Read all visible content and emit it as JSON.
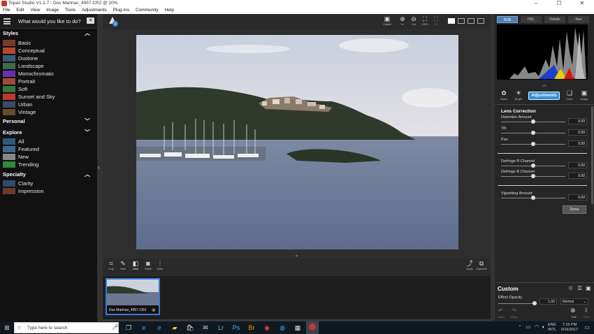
{
  "window": {
    "title": "Topaz Studio V1.2.7 - Dos Marinas_4957.CR2 @ 20%",
    "controls": [
      "–",
      "☐",
      "✕"
    ]
  },
  "menu": [
    "File",
    "Edit",
    "View",
    "Image",
    "Tools",
    "Adjustments",
    "Plug-ins",
    "Community",
    "Help"
  ],
  "search": {
    "placeholder": "What would you like to do?"
  },
  "styles": {
    "title": "Styles",
    "items": [
      {
        "label": "Basic",
        "color": "#7a3b2e"
      },
      {
        "label": "Conceptual",
        "color": "#b5482f"
      },
      {
        "label": "Duotone",
        "color": "#3a5a7a"
      },
      {
        "label": "Landscape",
        "color": "#3f6b4a"
      },
      {
        "label": "Monochromatic",
        "color": "#6a2fb0"
      },
      {
        "label": "Portrait",
        "color": "#a04a3a"
      },
      {
        "label": "Soft",
        "color": "#2f7a3a"
      },
      {
        "label": "Sunset and Sky",
        "color": "#c0392b"
      },
      {
        "label": "Urban",
        "color": "#3a4a6a"
      },
      {
        "label": "Vintage",
        "color": "#6a4a2a"
      }
    ]
  },
  "personal": {
    "title": "Personal"
  },
  "explore": {
    "title": "Explore",
    "items": [
      {
        "label": "All",
        "color": "#2f5a7a"
      },
      {
        "label": "Featured",
        "color": "#3a6a8a"
      },
      {
        "label": "New",
        "color": "#888888"
      },
      {
        "label": "Trending",
        "color": "#2f8a3a"
      }
    ]
  },
  "specialty": {
    "title": "Specialty",
    "items": [
      {
        "label": "Clarity",
        "color": "#2f4a6a"
      },
      {
        "label": "Impression",
        "color": "#6a3a2a"
      }
    ]
  },
  "topbar": {
    "original": "Original",
    "in": "In",
    "out": "Out",
    "zoom": "100%",
    "fit": "Fit"
  },
  "tools": {
    "crop": "Crop",
    "heal": "Heal",
    "lens": "Lens",
    "mask": "Mask",
    "more": "More",
    "apply": "Apply",
    "duplicate": "Duplicate"
  },
  "film": {
    "filename": "Dos Marinas_4957.CR2"
  },
  "right": {
    "tabs": [
      "RGB",
      "HSL",
      "Details",
      "Nav"
    ],
    "icons": [
      "Basic",
      "Bright",
      "Adjustments",
      "Color",
      "Image"
    ],
    "section": "Lens Correction",
    "sliders": [
      {
        "label": "Distortion Amount",
        "value": "0.00",
        "pos": 0.5
      },
      {
        "label": "Tilt",
        "value": "0.00",
        "pos": 0.5
      },
      {
        "label": "Pan",
        "value": "0.00",
        "pos": 0.5
      },
      {
        "label": "Defringe R Channel",
        "value": "0.00",
        "pos": 0.5
      },
      {
        "label": "Defringe B Channel",
        "value": "0.00",
        "pos": 0.5
      },
      {
        "label": "Vignetting Amount",
        "value": "0.00",
        "pos": 0.5
      }
    ],
    "done": "Done",
    "custom": "Custom",
    "effect_opacity": "Effect Opacity",
    "opacity_value": "1.00",
    "opacity_pos": 1.0,
    "blend_mode": "Normal",
    "undo": "Undo",
    "redo": "Redo",
    "exit": "Exit",
    "save": "Save"
  },
  "taskbar": {
    "search_placeholder": "Type here to search",
    "lang": "ENG",
    "lang2": "INTL",
    "time": "7:15 PM",
    "date": "9/16/2017"
  }
}
